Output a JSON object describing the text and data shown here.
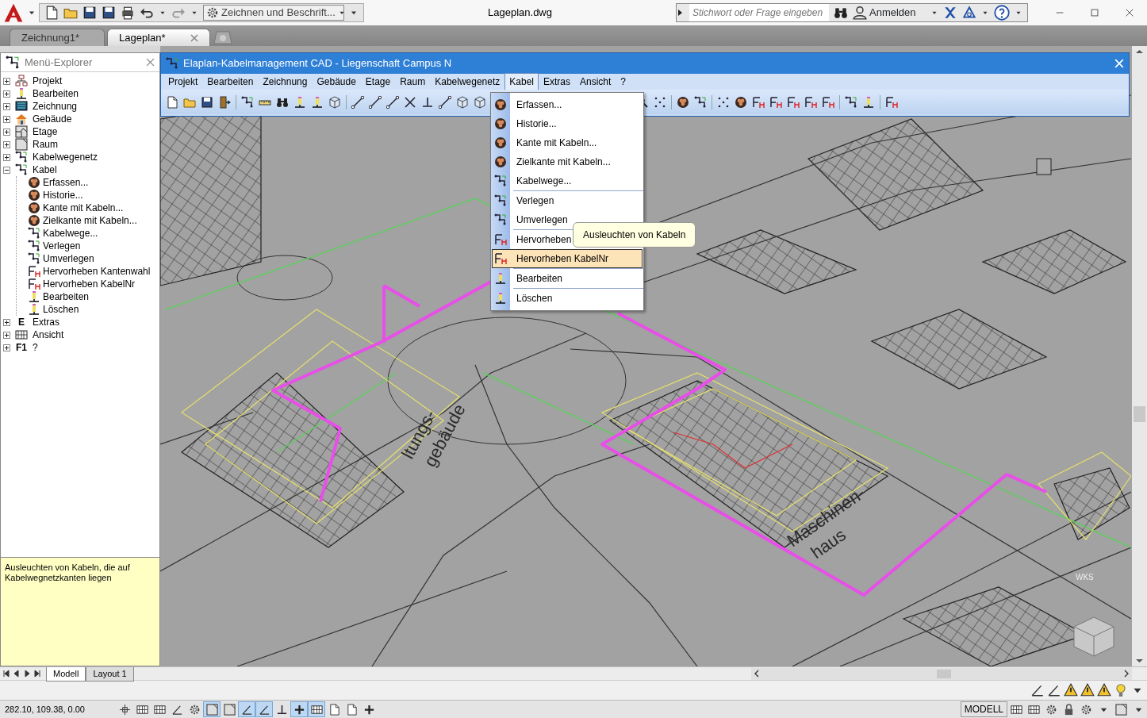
{
  "app_bar": {
    "workspace": "Zeichnen und Beschrift...",
    "title": "Lageplan.dwg",
    "search_placeholder": "Stichwort oder Frage eingeben",
    "sign_in": "Anmelden"
  },
  "doc_tabs": [
    {
      "label": "Zeichnung1*",
      "selected": false
    },
    {
      "label": "Lageplan*",
      "selected": true
    }
  ],
  "explorer": {
    "title": "Menü-Explorer",
    "tree": [
      {
        "label": "Projekt",
        "expanded": false
      },
      {
        "label": "Bearbeiten",
        "expanded": false
      },
      {
        "label": "Zeichnung",
        "expanded": false
      },
      {
        "label": "Gebäude",
        "expanded": false
      },
      {
        "label": "Etage",
        "expanded": false
      },
      {
        "label": "Raum",
        "expanded": false
      },
      {
        "label": "Kabelwegenetz",
        "expanded": false
      },
      {
        "label": "Kabel",
        "expanded": true,
        "children": [
          {
            "label": "Erfassen..."
          },
          {
            "label": "Historie..."
          },
          {
            "label": "Kante mit Kabeln..."
          },
          {
            "label": "Zielkante mit Kabeln..."
          },
          {
            "label": "Kabelwege..."
          },
          {
            "label": "Verlegen"
          },
          {
            "label": "Umverlegen"
          },
          {
            "label": "Hervorheben Kantenwahl"
          },
          {
            "label": "Hervorheben KabelNr"
          },
          {
            "label": "Bearbeiten"
          },
          {
            "label": "Löschen"
          }
        ]
      },
      {
        "label": "Extras",
        "expanded": false,
        "glyph": "E"
      },
      {
        "label": "Ansicht",
        "expanded": false
      },
      {
        "label": "?",
        "expanded": false,
        "glyph": "F1"
      }
    ],
    "description": "Ausleuchten von Kabeln, die  auf Kabelwegnetzkanten liegen"
  },
  "plugin_window": {
    "title": "Elaplan-Kabelmanagement CAD - Liegenschaft Campus N",
    "menus": [
      {
        "label": "Projekt",
        "selected": false
      },
      {
        "label": "Bearbeiten",
        "selected": false
      },
      {
        "label": "Zeichnung",
        "selected": false
      },
      {
        "label": "Gebäude",
        "selected": false
      },
      {
        "label": "Etage",
        "selected": false
      },
      {
        "label": "Raum",
        "selected": false
      },
      {
        "label": "Kabelwegenetz",
        "selected": false
      },
      {
        "label": "Kabel",
        "selected": true
      },
      {
        "label": "Extras",
        "selected": false
      },
      {
        "label": "Ansicht",
        "selected": false
      },
      {
        "label": "?",
        "selected": false
      }
    ],
    "dropdown": [
      [
        {
          "label": "Erfassen...",
          "selected": false
        },
        {
          "label": "Historie...",
          "selected": false
        },
        {
          "label": "Kante mit Kabeln...",
          "selected": false
        },
        {
          "label": "Zielkante mit Kabeln...",
          "selected": false
        },
        {
          "label": "Kabelwege...",
          "selected": false
        }
      ],
      [
        {
          "label": "Verlegen",
          "selected": false
        },
        {
          "label": "Umverlegen",
          "selected": false
        }
      ],
      [
        {
          "label": "Hervorheben",
          "selected": false
        },
        {
          "label": "Hervorheben KabelNr",
          "selected": true
        }
      ],
      [
        {
          "label": "Bearbeiten",
          "selected": false
        }
      ],
      [
        {
          "label": "Löschen",
          "selected": false
        }
      ]
    ],
    "tooltip": "Ausleuchten von Kabeln"
  },
  "drawing_labels": [
    "ltungs-",
    "gebäude",
    "Maschinen-",
    "haus"
  ],
  "view_label": "WKS",
  "layout_tabs": [
    {
      "label": "Modell",
      "selected": true
    },
    {
      "label": "Layout 1",
      "selected": false
    }
  ],
  "status_bar": {
    "coordinates": "282.10, 109.38, 0.00",
    "space": "MODELL"
  }
}
